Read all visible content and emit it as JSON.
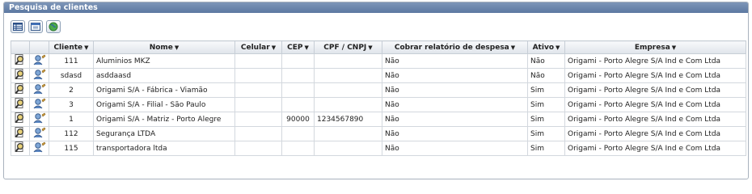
{
  "panel": {
    "title": "Pesquisa de clientes"
  },
  "toolbar": {
    "buttons": [
      "grid-icon",
      "window-icon",
      "globe-icon"
    ]
  },
  "table": {
    "columns": [
      "Cliente",
      "Nome",
      "Celular",
      "CEP",
      "CPF / CNPJ",
      "Cobrar relatório de despesa",
      "Ativo",
      "Empresa"
    ],
    "rows": [
      {
        "cliente": "111",
        "nome": "Aluminios MKZ",
        "celular": "",
        "cep": "",
        "cpf": "",
        "cobrar": "Não",
        "ativo": "Não",
        "empresa": "Origami - Porto Alegre S/A Ind e Com Ltda"
      },
      {
        "cliente": "sdasd",
        "nome": "asddaasd",
        "celular": "",
        "cep": "",
        "cpf": "",
        "cobrar": "Não",
        "ativo": "Não",
        "empresa": "Origami - Porto Alegre S/A Ind e Com Ltda"
      },
      {
        "cliente": "2",
        "nome": "Origami S/A - Fábrica - Viamão",
        "celular": "",
        "cep": "",
        "cpf": "",
        "cobrar": "Não",
        "ativo": "Sim",
        "empresa": "Origami - Porto Alegre S/A Ind e Com Ltda"
      },
      {
        "cliente": "3",
        "nome": "Origami S/A - Filial - São Paulo",
        "celular": "",
        "cep": "",
        "cpf": "",
        "cobrar": "Não",
        "ativo": "Sim",
        "empresa": "Origami - Porto Alegre S/A Ind e Com Ltda"
      },
      {
        "cliente": "1",
        "nome": "Origami S/A - Matriz - Porto Alegre",
        "celular": "",
        "cep": "90000",
        "cpf": "1234567890",
        "cobrar": "Não",
        "ativo": "Sim",
        "empresa": "Origami - Porto Alegre S/A Ind e Com Ltda"
      },
      {
        "cliente": "112",
        "nome": "Segurança LTDA",
        "celular": "",
        "cep": "",
        "cpf": "",
        "cobrar": "Não",
        "ativo": "Sim",
        "empresa": "Origami - Porto Alegre S/A Ind e Com Ltda"
      },
      {
        "cliente": "115",
        "nome": "transportadora ltda",
        "celular": "",
        "cep": "",
        "cpf": "",
        "cobrar": "Não",
        "ativo": "Sim",
        "empresa": "Origami - Porto Alegre S/A Ind e Com Ltda"
      }
    ]
  },
  "colors": {
    "header_bg": "#6a84ad",
    "border": "#c7ced6"
  }
}
